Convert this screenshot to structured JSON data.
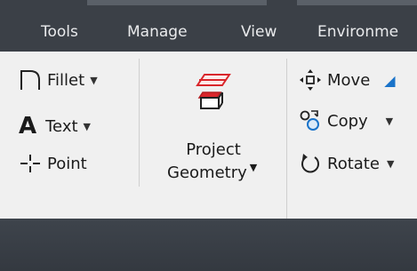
{
  "menubar": {
    "items": [
      "Tools",
      "Manage",
      "View",
      "Environme"
    ]
  },
  "ribbon": {
    "draw": {
      "fillet": "Fillet",
      "text": "Text",
      "point": "Point"
    },
    "project_geometry": {
      "line1": "Project",
      "line2": "Geometry"
    },
    "modify": {
      "move": "Move",
      "copy": "Copy",
      "rotate": "Rotate"
    }
  },
  "colors": {
    "menubar_bg": "#3b4047",
    "menu_text": "#e9eaec",
    "ribbon_bg": "#f0f0f0",
    "accent_red": "#d9262b",
    "accent_blue": "#1a73c9"
  },
  "icons": [
    "fillet-icon",
    "text-a-icon",
    "point-icon",
    "project-geometry-icon",
    "move-icon",
    "copy-icon",
    "rotate-icon"
  ]
}
